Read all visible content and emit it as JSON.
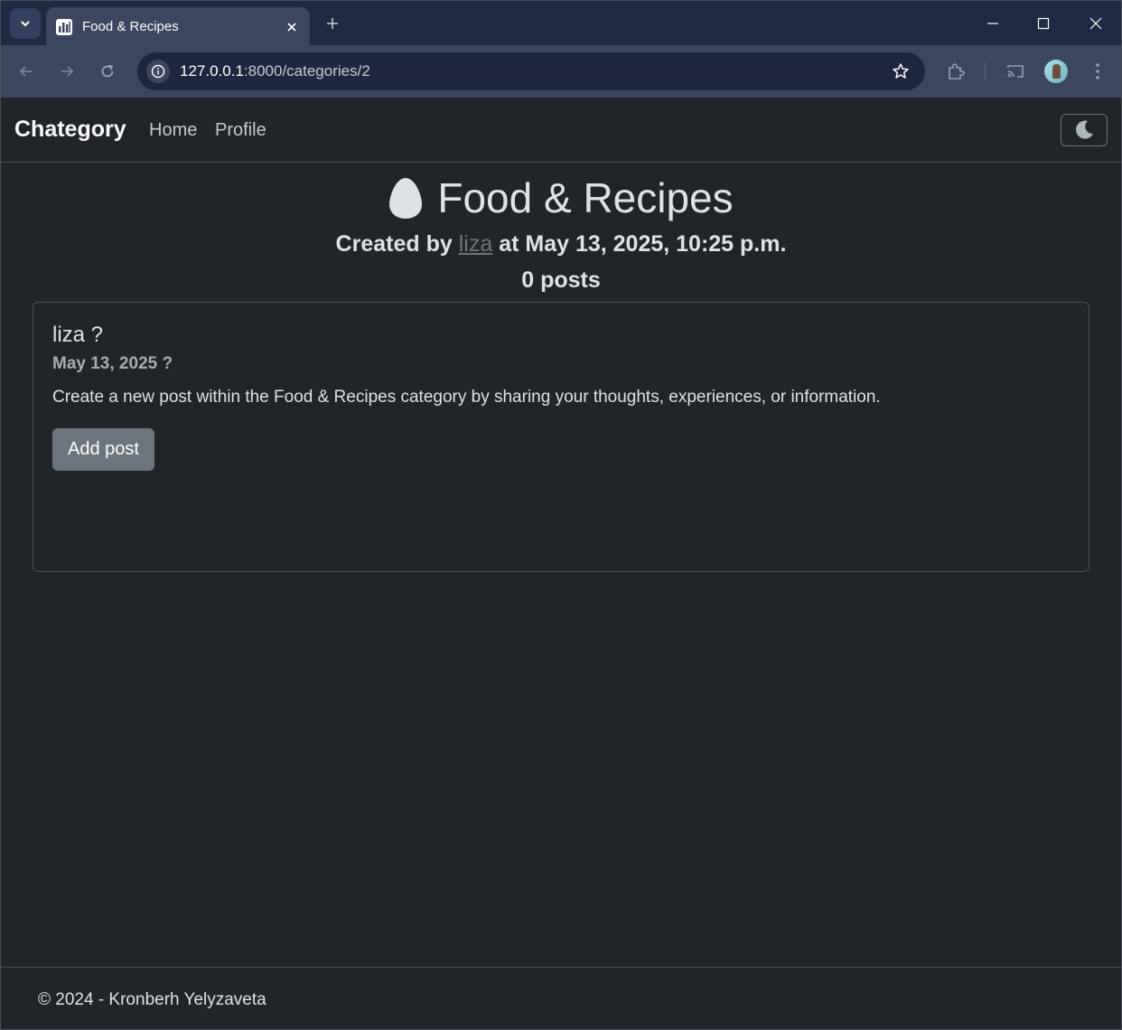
{
  "browser": {
    "tab": {
      "title": "Food & Recipes",
      "favicon": "bar-chart-icon"
    },
    "url": {
      "host": "127.0.0.1",
      "path": ":8000/categories/2"
    }
  },
  "navbar": {
    "brand": "Chategory",
    "links": [
      "Home",
      "Profile"
    ],
    "theme_toggle_icon": "moon-icon"
  },
  "category": {
    "icon": "egg-icon",
    "title": "Food & Recipes",
    "created_prefix": "Created by",
    "author": "liza",
    "created_suffix": "at May 13, 2025, 10:25 p.m.",
    "posts_count": "0 posts"
  },
  "new_post_card": {
    "author": "liza ?",
    "date": "May 13, 2025 ?",
    "text": "Create a new post within the Food & Recipes category by sharing your thoughts, experiences, or information.",
    "button": "Add post"
  },
  "footer": {
    "text": "© 2024 - Kronberh Yelyzaveta"
  },
  "colors": {
    "page_bg": "#212529",
    "tabstrip_bg": "#202a44",
    "toolbar_bg": "#3c4660",
    "button_secondary": "#6c757d"
  }
}
